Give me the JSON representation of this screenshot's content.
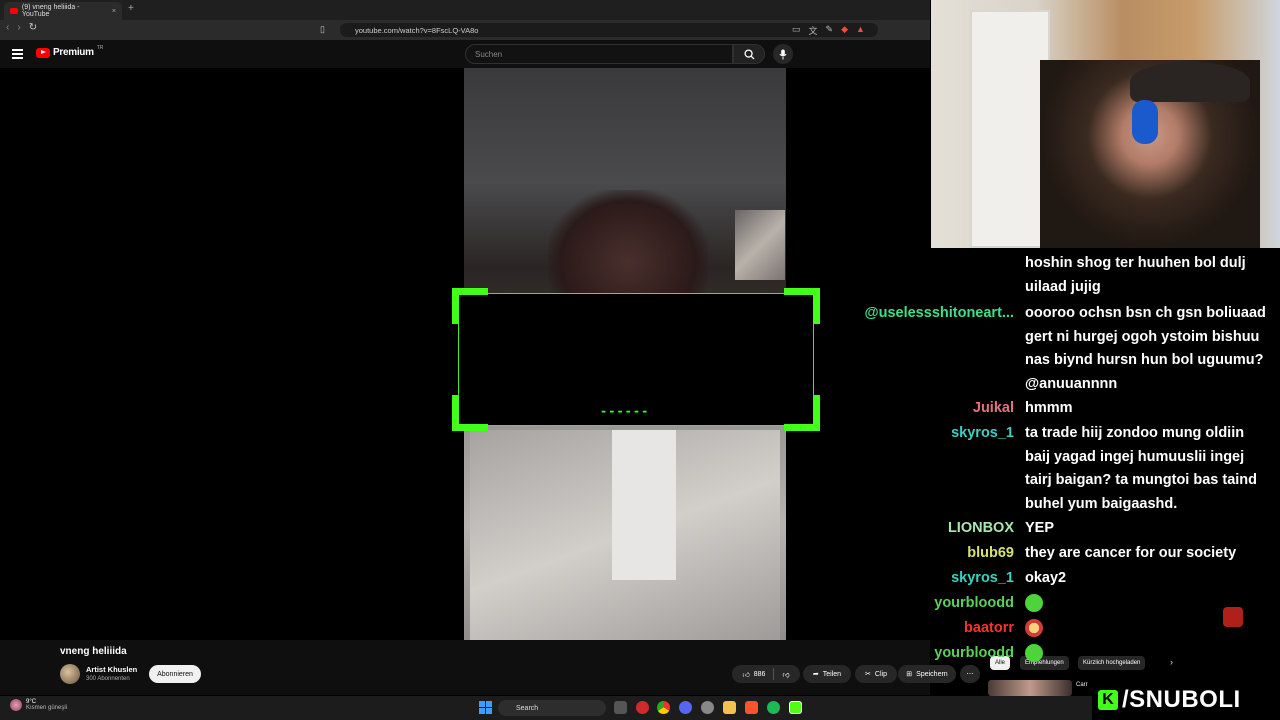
{
  "browser": {
    "tab_title": "(9) vneng heliiida - YouTube",
    "tab_close": "×",
    "new_tab": "+",
    "url": "youtube.com/watch?v=8FscLQ-VA8o"
  },
  "youtube": {
    "logo_text": "Premium",
    "region": "TR",
    "search_placeholder": "Suchen"
  },
  "video": {
    "title": "vneng heliiida",
    "channel": "Artist Khuslen",
    "subscribers": "300 Abonnenten",
    "subscribe_label": "Abonnieren",
    "likes": "886",
    "share_label": "Teilen",
    "clip_label": "Clip",
    "save_label": "Speichern",
    "more_label": "⋯",
    "overlay_text": "------"
  },
  "chips": {
    "all": "Alle",
    "recommended": "Empfehlungen",
    "recent": "Kürzlich hochgeladen",
    "next": "›"
  },
  "related": {
    "title_partial": "Carr"
  },
  "chat": {
    "messages": [
      {
        "user": "",
        "color": "#ffffff",
        "text": "hoshin shog ter huuhen bol dulj uilaad jujig"
      },
      {
        "user": "@uselessshitoneart...",
        "color": "#3de08a",
        "text": "oooroo ochsn bsn ch gsn boliuaad gert ni hurgej ogoh ystoim bishuu nas biynd hursn hun bol uguumu? @anuuannnn"
      },
      {
        "user": "Juikal",
        "color": "#e8707a",
        "text": "hmmm"
      },
      {
        "user": "skyros_1",
        "color": "#3cd0c0",
        "text": "ta trade hiij zondoo mung oldiin baij yagad ingej humuuslii ingej tairj baigan? ta mungtoi bas taind buhel yum baigaashd."
      },
      {
        "user": "LIONBOX",
        "color": "#a8e8b0",
        "text": "YEP"
      },
      {
        "user": "blub69",
        "color": "#d8e070",
        "text": "they are cancer for our society"
      },
      {
        "user": "skyros_1",
        "color": "#3cd0c0",
        "text": "okay2"
      },
      {
        "user": "yourbloodd",
        "color": "#5ad05a",
        "text": "",
        "emote": "green-blob-emote"
      },
      {
        "user": "baatorr",
        "color": "#ff3030",
        "text": "",
        "emote": "red-face-emote"
      },
      {
        "user": "yourbloodd",
        "color": "#5ad05a",
        "text": "",
        "emote": "green-blob-emote"
      }
    ]
  },
  "watermark": {
    "letter": "K",
    "name": "/SNUBOLI"
  },
  "taskbar": {
    "weather_temp": "9°C",
    "weather_desc": "Kısmen güneşli",
    "search_label": "Search"
  },
  "colors": {
    "accent_green": "#42ff1a",
    "youtube_red": "#ff0000"
  }
}
